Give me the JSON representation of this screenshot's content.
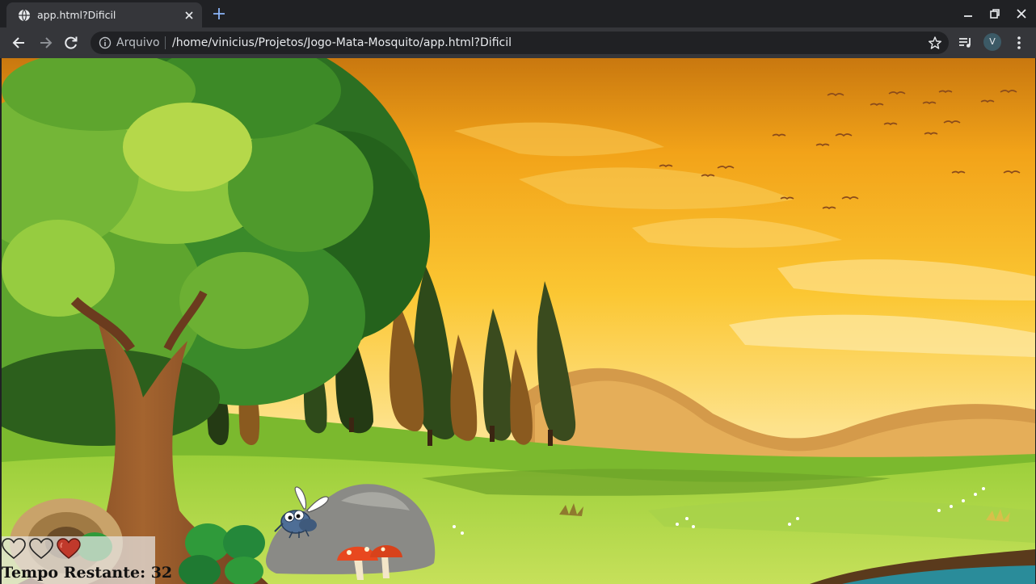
{
  "browser": {
    "tab_title": "app.html?Dificil",
    "scheme_label": "Arquivo",
    "url": "/home/vinicius/Projetos/Jogo-Mata-Mosquito/app.html?Dificil",
    "profile_initial": "V"
  },
  "game": {
    "hud": {
      "lives": [
        {
          "state": "empty"
        },
        {
          "state": "empty"
        },
        {
          "state": "full"
        }
      ],
      "timer_label": "Tempo Restante: ",
      "timer_value": "32",
      "full_heart_color": "#c0392b"
    },
    "target": {
      "icon": "mosquito-icon",
      "body_color": "#4e6e96"
    }
  }
}
